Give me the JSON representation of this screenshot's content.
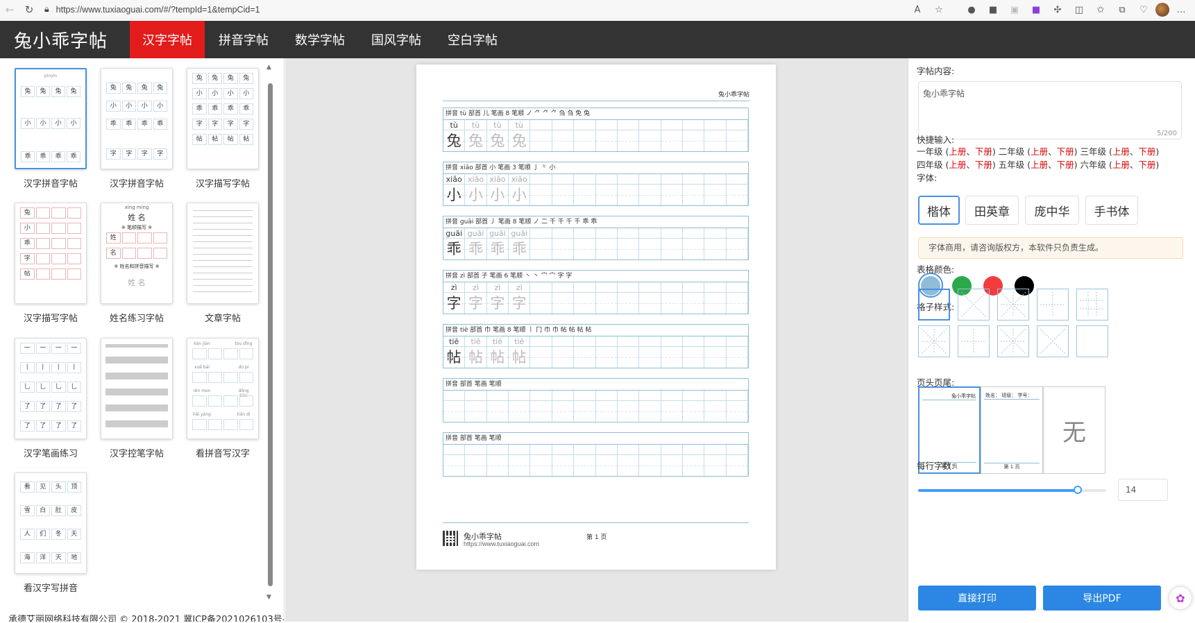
{
  "browser": {
    "url": "https://www.tuxiaoguai.com/#/?tempId=1&tempCid=1"
  },
  "nav": {
    "logo": "兔小乖字帖",
    "items": [
      {
        "label": "汉字字帖",
        "active": true
      },
      {
        "label": "拼音字帖"
      },
      {
        "label": "数学字帖"
      },
      {
        "label": "国风字帖"
      },
      {
        "label": "空白字帖"
      }
    ]
  },
  "templates": [
    {
      "name": "汉字拼音字帖"
    },
    {
      "name": "汉字拼音字帖"
    },
    {
      "name": "汉字描写字帖"
    },
    {
      "name": "汉字描写字帖"
    },
    {
      "name": "姓名练习字帖"
    },
    {
      "name": "文章字帖"
    },
    {
      "name": "汉字笔画练习"
    },
    {
      "name": "汉字控笔字帖"
    },
    {
      "name": "看拼音写汉字"
    },
    {
      "name": "看汉字写拼音"
    }
  ],
  "thumb_texts": {
    "t1": [
      "兔",
      "兔",
      "兔",
      "兔",
      "小",
      "小",
      "小",
      "小",
      "乖",
      "乖",
      "乖",
      "乖"
    ],
    "t3": [
      "兔",
      "兔",
      "兔",
      "兔",
      "小",
      "小",
      "小",
      "小",
      "乖",
      "乖",
      "乖",
      "乖",
      "字",
      "字",
      "字",
      "字",
      "帖",
      "帖",
      "帖",
      "帖"
    ],
    "t5_pinyin": "xìng míng",
    "t5_name": "姓 名",
    "t5_a": "※ 笔顺描写 ※",
    "t5_b": "※ 姓名和拼音描写 ※",
    "t10": [
      "看",
      "见",
      "头",
      "顶",
      "雪",
      "白",
      "肚",
      "皮",
      "人",
      "们",
      "冬",
      "天",
      "海",
      "洋",
      "天",
      "地"
    ]
  },
  "footer": "承德艾丽网络科技有限公司 © 2018-2021 冀ICP备2021026103号-1",
  "paper": {
    "header": "兔小乖字帖",
    "rows": [
      {
        "info": "拼音 tù   部首 儿   笔画 8   笔顺  ノ ⺈ ⺈ ⺈ 刍 刍 免 兔",
        "pinyin": "tù",
        "char": "兔"
      },
      {
        "info": "拼音 xiǎo   部首 小   笔画 3   笔顺  亅 ⺀ 小",
        "pinyin": "xiǎo",
        "char": "小"
      },
      {
        "info": "拼音 guāi   部首 丿   笔画 8   笔顺  ノ 二 千 千 千 千 乖 乖",
        "pinyin": "guāi",
        "char": "乖"
      },
      {
        "info": "拼音 zì   部首 子   笔画 6   笔顺  丶 丶 宀 宀 字 字",
        "pinyin": "zì",
        "char": "字"
      },
      {
        "info": "拼音 tiē   部首 巾   笔画 8   笔顺  丨 冂 巾 巾 帖 帖 帖 帖",
        "pinyin": "tiē",
        "char": "帖"
      },
      {
        "info": "拼音   部首   笔画   笔顺",
        "pinyin": "",
        "char": ""
      },
      {
        "info": "拼音   部首   笔画   笔顺",
        "pinyin": "",
        "char": ""
      }
    ],
    "footer_name": "兔小乖字帖",
    "footer_url": "https://www.tuxiaoguai.com",
    "page": "第 1 页"
  },
  "right": {
    "content_label": "字帖内容:",
    "content_value": "兔小乖字帖",
    "counter": "5/200",
    "quick_label": "快捷输入:",
    "quick_line1": [
      "一年级 (",
      "上册",
      "、",
      "下册",
      ")  二年级 (",
      "上册",
      "、",
      "下册",
      ")  三年级 (",
      "上册",
      "、",
      "下册",
      ")"
    ],
    "quick_line2": [
      "四年级 (",
      "上册",
      "、",
      "下册",
      ")  五年级 (",
      "上册",
      "、",
      "下册",
      ")  六年级 (",
      "上册",
      "、",
      "下册",
      ")"
    ],
    "font_label": "字体:",
    "fonts": [
      "楷体",
      "田英章",
      "庞中华",
      "手书体"
    ],
    "warning": "字体商用，请咨询版权方，本软件只负责生成。",
    "color_label": "表格颜色:",
    "colors": [
      "#8fbcd9",
      "#2aa84a",
      "#f23c3c",
      "#000000"
    ],
    "grid_label": "格子样式:",
    "headfoot_label": "页头页尾:",
    "hf1_head": "兔小乖字帖",
    "hf1_foot": "第 1 页",
    "hf2_head": "姓名：   班级：   学号：",
    "hf2_foot": "第 1 页",
    "hf3": "无",
    "per_row_label": "每行字数:",
    "per_row_value": "14",
    "per_row_fraction": 0.85,
    "print_btn": "直接打印",
    "pdf_btn": "导出PDF"
  }
}
